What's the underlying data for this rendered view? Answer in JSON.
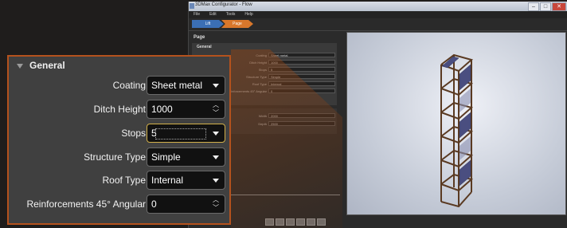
{
  "window": {
    "title": "3DMax Configurator - Flow",
    "menu": [
      "File",
      "Edit",
      "Tools",
      "Help"
    ],
    "breadcrumbs": [
      "Lift",
      "Page"
    ]
  },
  "page_label": "Page",
  "general": {
    "header": "General",
    "coating": {
      "label": "Coating",
      "value": "Sheet metal"
    },
    "ditch_height": {
      "label": "Ditch Height",
      "value": "1000"
    },
    "stops": {
      "label": "Stops",
      "value": "5"
    },
    "structure_type": {
      "label": "Structure Type",
      "value": "Simple"
    },
    "roof_type": {
      "label": "Roof Type",
      "value": "Internal"
    },
    "reinforcements": {
      "label": "Reinforcements 45° Angular",
      "value": "0"
    }
  },
  "dimensions": {
    "width": {
      "label": "Width",
      "value": "2000"
    },
    "depth": {
      "label": "Depth",
      "value": "2500"
    }
  },
  "colors": {
    "accent_orange": "#b4521d",
    "breadcrumb_blue": "#3b6fb5",
    "breadcrumb_orange": "#d9772b"
  }
}
